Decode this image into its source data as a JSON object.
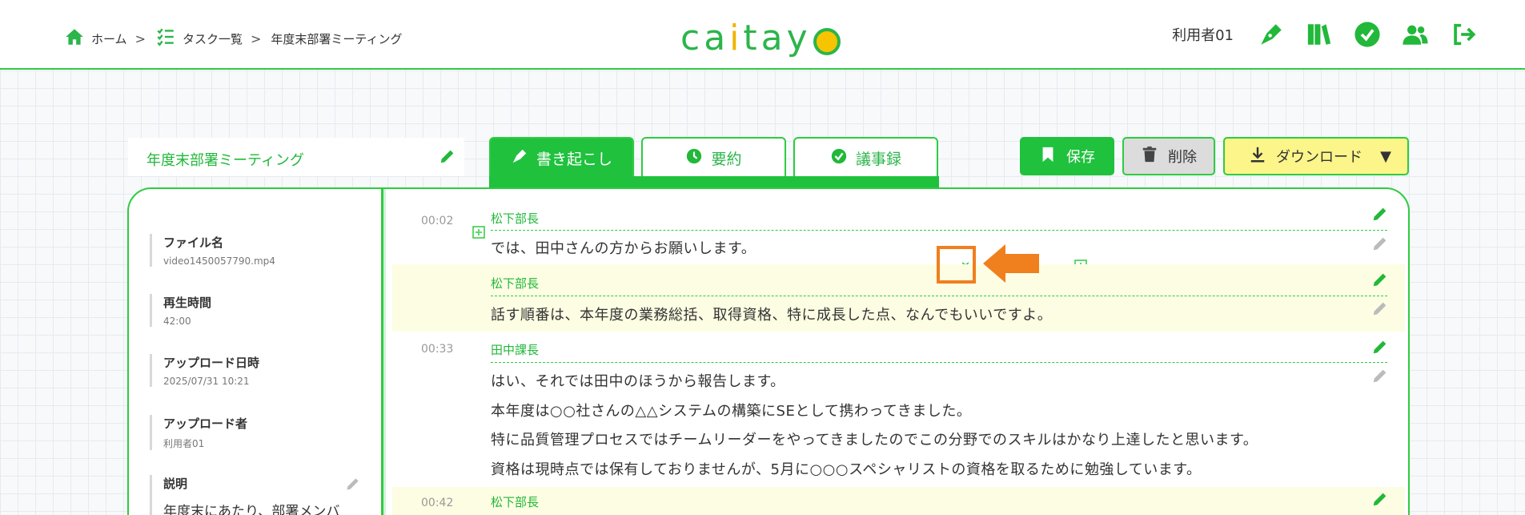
{
  "breadcrumb": {
    "home": "ホーム",
    "tasks": "タスク一覧",
    "current": "年度末部署ミーティング"
  },
  "logo": {
    "text_a": "ca",
    "text_b": "i",
    "text_c": "tay"
  },
  "user": {
    "name": "利用者01"
  },
  "doc": {
    "title": "年度末部署ミーティング"
  },
  "tabs": [
    {
      "label": "書き起こし",
      "icon": "pen-nib-icon",
      "active": true
    },
    {
      "label": "要約",
      "icon": "clock-icon",
      "active": false
    },
    {
      "label": "議事録",
      "icon": "check-circle-icon",
      "active": false
    }
  ],
  "actions": {
    "save": "保存",
    "delete": "削除",
    "download": "ダウンロード",
    "download_caret": "▼"
  },
  "meta": {
    "file_label": "ファイル名",
    "file_value": "video1450057790.mp4",
    "duration_label": "再生時間",
    "duration_value": "42:00",
    "upload_date_label": "アップロード日時",
    "upload_date_value": "2025/07/31 10:21",
    "uploader_label": "アップロード者",
    "uploader_value": "利用者01",
    "desc_label": "説明",
    "desc_value": "年度末にあたり、部署メンバ"
  },
  "segments": [
    {
      "time": "00:02",
      "speaker": "松下部長",
      "lines": [
        "では、田中さんの方からお願いします。"
      ],
      "highlight": false
    },
    {
      "time": "",
      "speaker": "松下部長",
      "lines": [
        "話す順番は、本年度の業務総括、取得資格、特に成長した点、なんでもいいですよ。"
      ],
      "highlight": true
    },
    {
      "time": "00:33",
      "speaker": "田中課長",
      "lines": [
        "はい、それでは田中のほうから報告します。",
        "本年度は○○社さんの△△システムの構築にSEとして携わってきました。",
        "特に品質管理プロセスではチームリーダーをやってきましたのでこの分野でのスキルはかなり上達したと思います。",
        "資格は現時点では保有しておりませんが、5月に○○○スペシャリストの資格を取るために勉強しています。"
      ],
      "highlight": false
    },
    {
      "time": "00:42",
      "speaker": "松下部長",
      "lines": [],
      "highlight": true
    }
  ],
  "colors": {
    "accent": "#1fc13d",
    "highlight": "#fdfde3",
    "download_bg": "#fbf58a",
    "annotation": "#f07f1e"
  }
}
